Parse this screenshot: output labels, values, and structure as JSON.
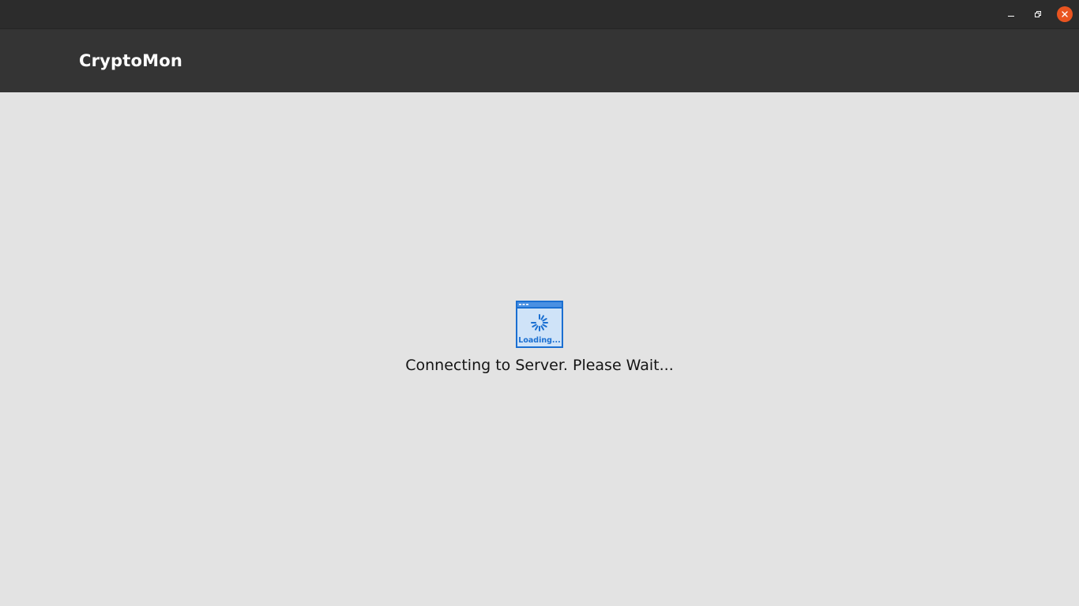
{
  "window": {
    "controls": {
      "minimize_icon": "minimize-icon",
      "maximize_icon": "restore-icon",
      "close_icon": "close-icon",
      "close_color": "#e95420"
    }
  },
  "header": {
    "title": "CryptoMon",
    "background": "#343434"
  },
  "main": {
    "loader": {
      "icon": "loading-window-icon",
      "label": "Loading...",
      "color": "#1a6fd1"
    },
    "status_message": "Connecting to Server. Please Wait..."
  }
}
